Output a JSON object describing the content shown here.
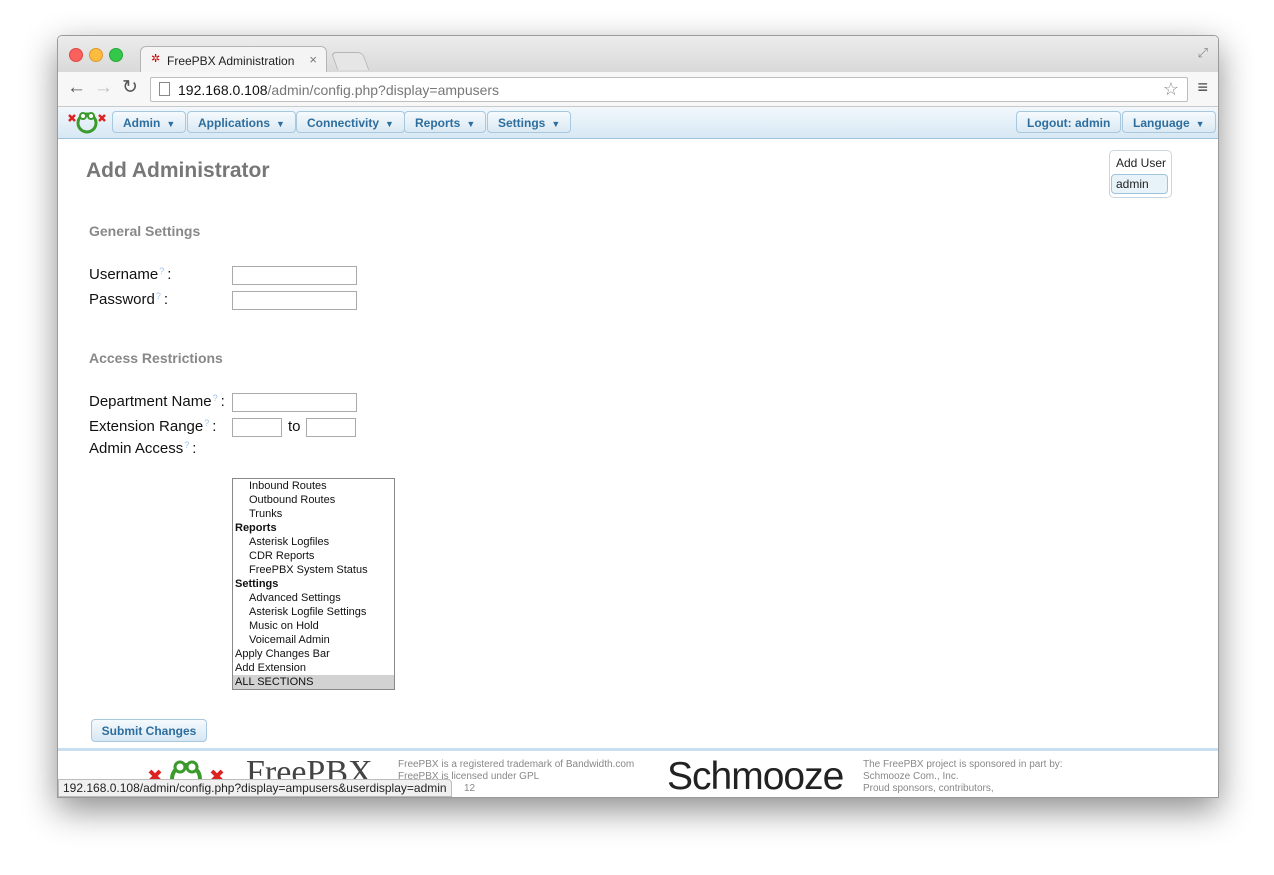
{
  "browser": {
    "tab_title": "FreePBX Administration",
    "tab_close": "×",
    "url_host": "192.168.0.108",
    "url_path": "/admin/config.php?display=ampusers",
    "status_url": "192.168.0.108/admin/config.php?display=ampusers&userdisplay=admin"
  },
  "nav": {
    "admin": "Admin",
    "applications": "Applications",
    "connectivity": "Connectivity",
    "reports": "Reports",
    "settings": "Settings",
    "logout": "Logout: admin",
    "language": "Language",
    "caret": "▼"
  },
  "page": {
    "title": "Add Administrator",
    "right_nav": {
      "add_user": "Add User",
      "admin": "admin"
    }
  },
  "form": {
    "general_settings": "General Settings",
    "username_label": "Username",
    "password_label": "Password",
    "access_restrictions": "Access Restrictions",
    "department_label": "Department Name",
    "extension_range_label": "Extension Range",
    "to_label": "to",
    "admin_access_label": "Admin Access",
    "colon": ":",
    "help": "?",
    "admin_access_options": [
      {
        "label": "Inbound Routes",
        "kind": "option"
      },
      {
        "label": "Outbound Routes",
        "kind": "option"
      },
      {
        "label": "Trunks",
        "kind": "option"
      },
      {
        "label": "Reports",
        "kind": "group"
      },
      {
        "label": "Asterisk Logfiles",
        "kind": "option"
      },
      {
        "label": "CDR Reports",
        "kind": "option"
      },
      {
        "label": "FreePBX System Status",
        "kind": "option"
      },
      {
        "label": "Settings",
        "kind": "group"
      },
      {
        "label": "Advanced Settings",
        "kind": "option"
      },
      {
        "label": "Asterisk Logfile Settings",
        "kind": "option"
      },
      {
        "label": "Music on Hold",
        "kind": "option"
      },
      {
        "label": "Voicemail Admin",
        "kind": "option"
      },
      {
        "label": "Apply Changes Bar",
        "kind": "plain"
      },
      {
        "label": "Add Extension",
        "kind": "plain"
      },
      {
        "label": "ALL SECTIONS",
        "kind": "plain",
        "selected": true
      }
    ],
    "submit": "Submit Changes"
  },
  "footer": {
    "brand": "FreePBX",
    "trademark_line1": "FreePBX is a registered trademark of Bandwidth.com",
    "trademark_line2": "FreePBX is licensed under GPL",
    "trademark_line3": "12",
    "schmooze": "Schmooze",
    "sponsor_line1": "The FreePBX project is sponsored in part by:",
    "sponsor_line2": "Schmooze Com., Inc.",
    "sponsor_line3": "Proud sponsors, contributors,"
  }
}
